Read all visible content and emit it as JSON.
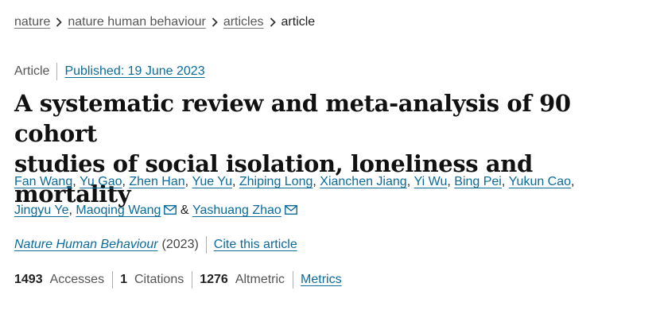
{
  "breadcrumb": {
    "items": [
      {
        "label": "nature",
        "link": true
      },
      {
        "label": "nature human behaviour",
        "link": true
      },
      {
        "label": "articles",
        "link": true
      },
      {
        "label": "article",
        "link": false
      }
    ],
    "separator_icon": "chevron-right-icon"
  },
  "meta": {
    "type": "Article",
    "published": "Published: 19 June 2023"
  },
  "title": {
    "line1": "A systematic review and meta-analysis of 90 cohort",
    "line2": "studies of social isolation, loneliness and mortality"
  },
  "authors": {
    "list": [
      {
        "name": "Fan Wang",
        "sep": ", "
      },
      {
        "name": "Yu Gao",
        "sep": ", "
      },
      {
        "name": "Zhen Han",
        "sep": ", "
      },
      {
        "name": "Yue Yu",
        "sep": ", "
      },
      {
        "name": "Zhiping Long",
        "sep": ", "
      },
      {
        "name": "Xianchen Jiang",
        "sep": ", "
      },
      {
        "name": "Yi Wu",
        "sep": ", "
      },
      {
        "name": "Bing Pei",
        "sep": ", "
      },
      {
        "name": "Yukun Cao",
        "sep": ", "
      },
      {
        "name": "Jingyu Ye",
        "sep": ", "
      },
      {
        "name": "Maoqing Wang",
        "sep": " & "
      },
      {
        "name": "Yashuang Zhao",
        "sep": ""
      }
    ],
    "corresponding_icon": "mail-icon"
  },
  "journal": {
    "name": "Nature Human Behaviour",
    "year": "(2023)",
    "cite_label": "Cite this article"
  },
  "metrics": {
    "accesses_value": "1493",
    "accesses_label": "Accesses",
    "citations_value": "1",
    "citations_label": "Citations",
    "altmetric_value": "1276",
    "altmetric_label": "Altmetric",
    "metrics_link": "Metrics"
  },
  "colors": {
    "link": "#0b6b9a",
    "text": "#222222",
    "muted": "#555555"
  }
}
